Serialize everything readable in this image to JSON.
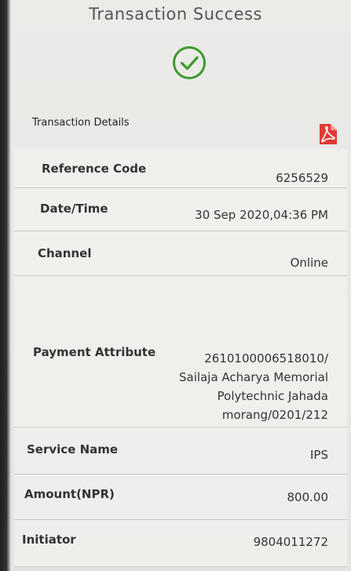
{
  "header": {
    "title": "Transaction Success",
    "status_icon": "check-circle-icon",
    "accent_color": "#3d9a2f"
  },
  "details": {
    "section_label": "Transaction Details",
    "download_icon": "pdf-icon",
    "pdf_color": "#e03a35",
    "rows": [
      {
        "label": "Reference Code",
        "value": "6256529"
      },
      {
        "label": "Date/Time",
        "value": "30 Sep 2020,04:36 PM"
      },
      {
        "label": "Channel",
        "value": "Online"
      },
      {
        "label": "Payment Attribute",
        "value_lines": [
          "2610100006518010/",
          "Sailaja Acharya Memorial",
          "Polytechnic Jahada",
          "morang/0201/212"
        ]
      },
      {
        "label": "Service Name",
        "value": "IPS"
      },
      {
        "label": "Amount(NPR)",
        "value": "800.00"
      },
      {
        "label": "Initiator",
        "value": "9804011272"
      }
    ]
  }
}
